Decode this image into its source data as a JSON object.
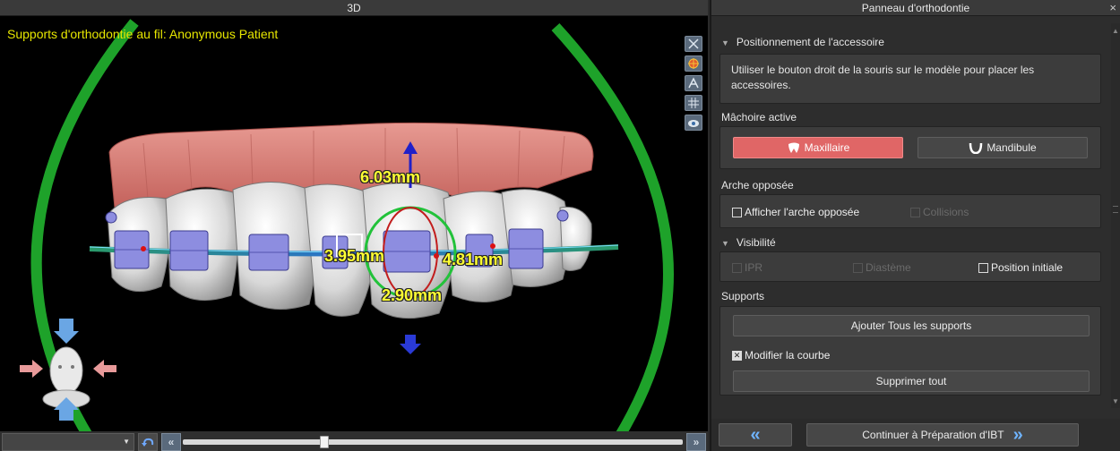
{
  "viewport": {
    "title": "3D",
    "caption": "Supports d'orthodontie au fil: Anonymous Patient",
    "measurements": {
      "top": "6.03mm",
      "left": "3.95mm",
      "right": "4.81mm",
      "bottom": "2.90mm"
    },
    "tools": [
      "cut-tool-icon",
      "landmark-tool-icon",
      "annotation-tool-icon",
      "grid-icon",
      "xray-view-icon"
    ],
    "view_select_value": "",
    "timeline_progress": 0.28
  },
  "panel": {
    "title": "Panneau d'orthodontie",
    "close": "×",
    "positioning": {
      "header": "Positionnement de l'accessoire",
      "instruction": "Utiliser le bouton droit de la souris sur le modèle pour placer les accessoires."
    },
    "jaw": {
      "header": "Mâchoire active",
      "maxillary": "Maxillaire",
      "mandible": "Mandibule",
      "active": "maxillary"
    },
    "opposite_arch": {
      "header": "Arche opposée",
      "show_label": "Afficher l'arche opposée",
      "collisions_label": "Collisions"
    },
    "visibility": {
      "header": "Visibilité",
      "ipr": "IPR",
      "diastema": "Diastème",
      "initial_position": "Position initiale"
    },
    "supports": {
      "header": "Supports",
      "add_all": "Ajouter Tous les supports",
      "modify_curve": "Modifier la courbe",
      "modify_curve_checked": true,
      "delete_all": "Supprimer tout"
    },
    "footer": {
      "back": "«",
      "continue": "Continuer à Préparation d'IBT",
      "continue_arrow": "»"
    }
  },
  "colors": {
    "accent_active": "#e06666",
    "caption_yellow": "#e6e600",
    "nav_blue": "#6fb4ff",
    "ring_green": "#1ea22a",
    "gum": "#d97a74",
    "bracket": "#8d8de0"
  }
}
